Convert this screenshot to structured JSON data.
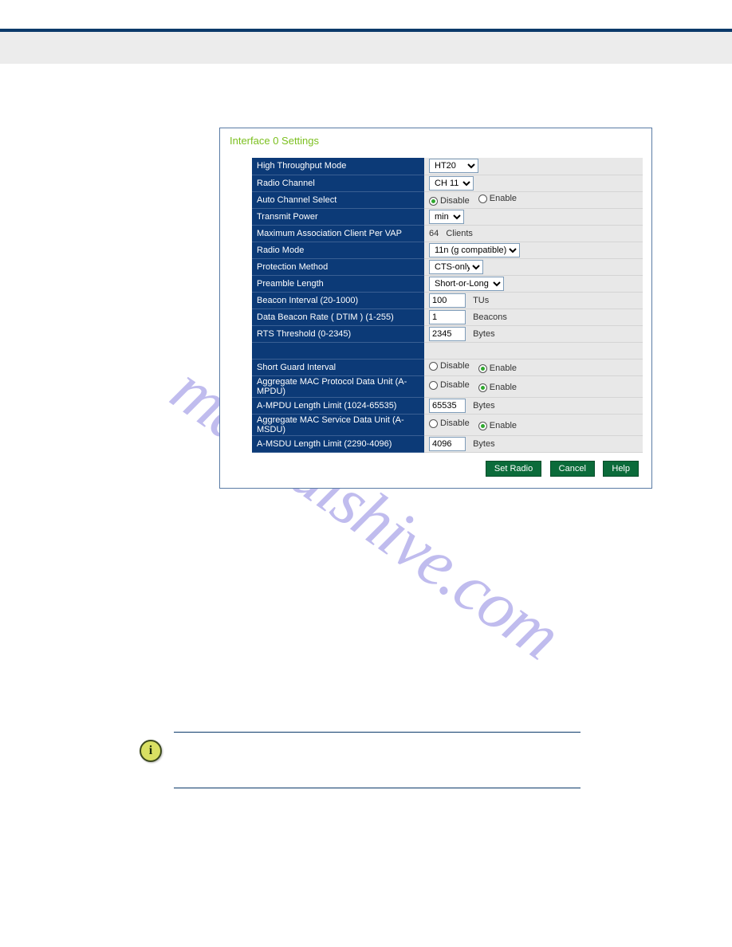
{
  "watermark": "manualshive.com",
  "panel": {
    "title": "Interface 0 Settings",
    "rows": {
      "ht_mode": {
        "label": "High Throughput Mode",
        "value": "HT20"
      },
      "radio_channel": {
        "label": "Radio Channel",
        "value": "CH 11"
      },
      "auto_channel": {
        "label": "Auto Channel Select",
        "disable": "Disable",
        "enable": "Enable",
        "selected": "disable"
      },
      "tx_power": {
        "label": "Transmit Power",
        "value": "min"
      },
      "max_assoc": {
        "label": "Maximum Association Client Per VAP",
        "value": "64",
        "unit": "Clients"
      },
      "radio_mode": {
        "label": "Radio Mode",
        "value": "11n (g compatible)"
      },
      "protection": {
        "label": "Protection Method",
        "value": "CTS-only"
      },
      "preamble": {
        "label": "Preamble Length",
        "value": "Short-or-Long"
      },
      "beacon": {
        "label": "Beacon Interval (20-1000)",
        "value": "100",
        "unit": "TUs"
      },
      "dtim": {
        "label": "Data Beacon Rate ( DTIM ) (1-255)",
        "value": "1",
        "unit": "Beacons"
      },
      "rts": {
        "label": "RTS Threshold (0-2345)",
        "value": "2345",
        "unit": "Bytes"
      },
      "sgi": {
        "label": "Short Guard Interval",
        "disable": "Disable",
        "enable": "Enable",
        "selected": "enable"
      },
      "ampdu": {
        "label": "Aggregate MAC Protocol Data Unit (A-MPDU)",
        "disable": "Disable",
        "enable": "Enable",
        "selected": "enable"
      },
      "ampdu_len": {
        "label": "A-MPDU Length Limit (1024-65535)",
        "value": "65535",
        "unit": "Bytes"
      },
      "amsdu": {
        "label": "Aggregate MAC Service Data Unit (A-MSDU)",
        "disable": "Disable",
        "enable": "Enable",
        "selected": "enable"
      },
      "amsdu_len": {
        "label": "A-MSDU Length Limit (2290-4096)",
        "value": "4096",
        "unit": "Bytes"
      }
    },
    "buttons": {
      "set": "Set Radio",
      "cancel": "Cancel",
      "help": "Help"
    }
  },
  "info_glyph": "i"
}
